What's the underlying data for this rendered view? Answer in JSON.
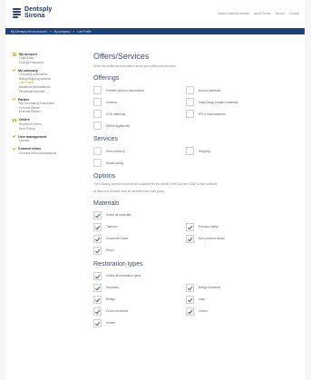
{
  "header": {
    "brand_line1": "Dentsply",
    "brand_line2": "Sirona",
    "top_links": [
      "Dental materials website",
      "About Sirona",
      "Service",
      "Contact"
    ]
  },
  "breadcrumb": [
    "My Dentsply Sirona account",
    "My company",
    "Lab Profile"
  ],
  "sidebar": {
    "groups": [
      {
        "title": "My account",
        "icon": "user-icon",
        "items": [
          "Login/Data",
          "Change Password"
        ]
      },
      {
        "title": "My company",
        "icon": "check-icon",
        "items": [
          "Company Information",
          "Billing/Shipping address",
          "Lab Profile",
          "Additional Workstations",
          "Deactivate Account"
        ],
        "active_index": 2
      },
      {
        "title": "Partner",
        "icon": "check-icon",
        "items": [
          "My Purchasing Franchisee",
          "Connect Dealer",
          "External Partner"
        ]
      },
      {
        "title": "Orders",
        "icon": "list-icon",
        "items": [
          "Received Orders",
          "Sent Orders"
        ]
      },
      {
        "title": "User management",
        "icon": "check-icon",
        "items": [
          "License"
        ]
      },
      {
        "title": "Connect Inbox",
        "icon": "check-icon",
        "items": [
          "Connect Inbox Workstations"
        ]
      }
    ]
  },
  "main": {
    "title": "Offers/Services",
    "intro": "Enter the additional information about your offers and services.",
    "offerings": {
      "title": "Offerings",
      "options": [
        {
          "label": "Esthetic anterior restorations",
          "checked": false
        },
        {
          "label": "Aurora materials",
          "checked": false
        },
        {
          "label": "Veneers",
          "checked": false
        },
        {
          "label": "Inlay/Onlay/ Implant materials",
          "checked": false
        },
        {
          "label": "VITA materials",
          "checked": false
        },
        {
          "label": "IPS e.max materials",
          "checked": false
        },
        {
          "label": "Online appliances",
          "checked": false
        }
      ]
    },
    "services": {
      "title": "Services",
      "options": [
        {
          "label": "Direct delivery",
          "checked": false
        },
        {
          "label": "Shipping",
          "checked": false
        },
        {
          "label": "Shade taking",
          "checked": false
        }
      ]
    },
    "options": {
      "title": "Options",
      "desc1": "The following selected services are available for the dentist in the Connect Case Center software.",
      "desc2": "At least one element must be selected from each group."
    },
    "materials": {
      "title": "Materials",
      "select_all": {
        "label": "Select all materials",
        "checked": true
      },
      "options": [
        {
          "label": "Titanium",
          "checked": true
        },
        {
          "label": "Precious Metal",
          "checked": true
        },
        {
          "label": "Zirconium Oxide",
          "checked": true
        },
        {
          "label": "Non-precious Metal",
          "checked": true
        },
        {
          "label": "Resin",
          "checked": true
        }
      ]
    },
    "restoration": {
      "title": "Restoration types",
      "select_all": {
        "label": "Select all restoration types",
        "checked": true
      },
      "options": [
        {
          "label": "Abutment",
          "checked": true
        },
        {
          "label": "Bridge veneered",
          "checked": true
        },
        {
          "label": "Bridge",
          "checked": true
        },
        {
          "label": "Inlay",
          "checked": true
        },
        {
          "label": "Crown veneered",
          "checked": true
        },
        {
          "label": "Crown",
          "checked": true
        },
        {
          "label": "Veneer",
          "checked": true
        }
      ]
    }
  }
}
